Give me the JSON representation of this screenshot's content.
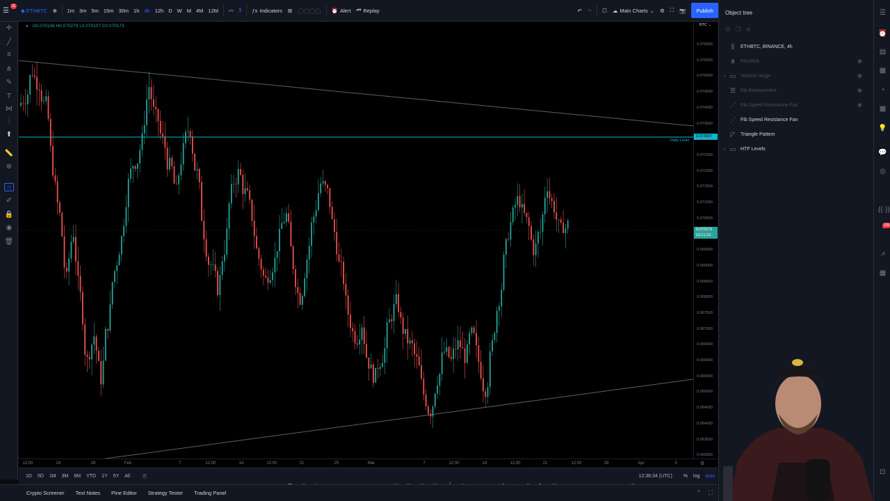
{
  "topbar": {
    "notif_count": "11",
    "symbol": "ETHBTC",
    "intervals": [
      "1m",
      "3m",
      "5m",
      "15m",
      "30m",
      "1h",
      "4h",
      "12h",
      "D",
      "W",
      "M",
      "4M",
      "12M"
    ],
    "active_interval": "4h",
    "indicators_label": "Indicators",
    "alert_label": "Alert",
    "replay_label": "Replay",
    "layout_name": "Main Charts",
    "publish_label": "Publish"
  },
  "chart": {
    "ohlc": "O0.070158 H0.070279 L0.070107 C0.070173",
    "daily_level_label": "Daily Level",
    "daily_level_price": "0.073097",
    "current_price": "0.070173",
    "countdown": "03:21:26",
    "axis_currency": "BTC"
  },
  "price_axis": [
    "0.076000",
    "0.075500",
    "0.075000",
    "0.074500",
    "0.074000",
    "0.073500",
    "0.073000",
    "0.072500",
    "0.072000",
    "0.071500",
    "0.071000",
    "0.070500",
    "0.070000",
    "0.069500",
    "0.069000",
    "0.068500",
    "0.068000",
    "0.067500",
    "0.067000",
    "0.066500",
    "0.066000",
    "0.065500",
    "0.065000",
    "0.064500",
    "0.064000",
    "0.063500",
    "0.063000"
  ],
  "time_axis": [
    "12:00",
    "24",
    "28",
    "Feb",
    "7",
    "12:00",
    "14",
    "12:00",
    "21",
    "25",
    "Mar",
    "7",
    "12:00",
    "14",
    "12:00",
    "21",
    "12:00",
    "28",
    "Apr",
    "5"
  ],
  "rangebar": {
    "ranges": [
      "1D",
      "5D",
      "1M",
      "3M",
      "6M",
      "YTD",
      "1Y",
      "5Y",
      "All"
    ],
    "clock": "12:38:34 (UTC)",
    "percent": "%",
    "log": "log",
    "auto": "auto"
  },
  "bottombar": {
    "tabs": [
      "Crypto Screener",
      "Text Notes",
      "Pine Editor",
      "Strategy Tester",
      "Trading Panel"
    ]
  },
  "object_tree": {
    "title": "Object tree",
    "items": [
      {
        "label": "ETHBTC, BINANCE, 4h",
        "dim": false
      },
      {
        "label": "Pitchfork",
        "dim": true
      },
      {
        "label": "Volume range",
        "dim": true
      },
      {
        "label": "Fib Retracement",
        "dim": true
      },
      {
        "label": "Fib Speed Resistance Fan",
        "dim": true
      },
      {
        "label": "Fib Speed Resistance Fan",
        "dim": false
      },
      {
        "label": "Triangle Pattern",
        "dim": false
      },
      {
        "label": "HTF Levels",
        "dim": false
      }
    ]
  },
  "rightbar": {
    "badge_count": "135"
  },
  "colors": {
    "bull": "#26a69a",
    "bear": "#ef5350",
    "accent": "#2962ff",
    "level": "#00bcd4"
  },
  "chart_data": {
    "type": "candlestick",
    "y_range": [
      0.063,
      0.0765
    ],
    "close_series": [
      0.0742,
      0.075,
      0.0746,
      0.0739,
      0.072,
      0.0705,
      0.0685,
      0.07,
      0.068,
      0.066,
      0.0668,
      0.0655,
      0.0672,
      0.0688,
      0.0698,
      0.0715,
      0.0722,
      0.0728,
      0.0745,
      0.0735,
      0.0728,
      0.072,
      0.0712,
      0.0725,
      0.0732,
      0.0718,
      0.07,
      0.069,
      0.0683,
      0.0695,
      0.0712,
      0.0718,
      0.0712,
      0.0705,
      0.0692,
      0.0685,
      0.069,
      0.0698,
      0.0705,
      0.069,
      0.068,
      0.0692,
      0.0705,
      0.0715,
      0.0712,
      0.07,
      0.0688,
      0.0675,
      0.0668,
      0.0672,
      0.066,
      0.0655,
      0.0662,
      0.0672,
      0.0678,
      0.067,
      0.0665,
      0.066,
      0.065,
      0.0645,
      0.0655,
      0.0663,
      0.066,
      0.0665,
      0.0662,
      0.0668,
      0.066,
      0.0652,
      0.0665,
      0.068,
      0.0695,
      0.0705,
      0.071,
      0.0703,
      0.0695,
      0.07,
      0.0715,
      0.0708,
      0.07,
      0.0702
    ]
  }
}
